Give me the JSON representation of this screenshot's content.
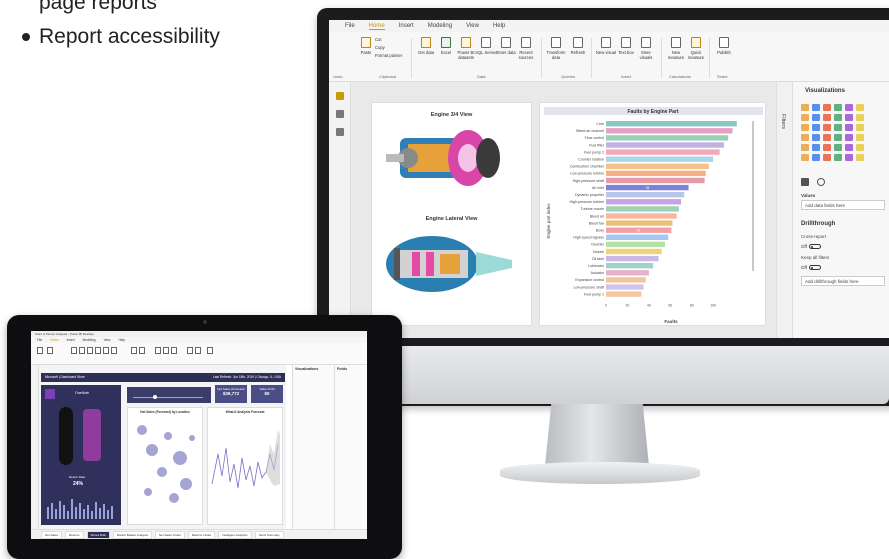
{
  "bullets": {
    "line1": "page reports",
    "line2": "Report accessibility"
  },
  "desktop": {
    "ribbon_tabs": [
      "File",
      "Home",
      "Insert",
      "Modeling",
      "View",
      "Help"
    ],
    "active_tab": "Home",
    "buttons": [
      "Paste",
      "Cut",
      "Copy",
      "Format painter",
      "Get data",
      "Excel",
      "Power BI datasets",
      "SQL Server",
      "Enter data",
      "Recent sources",
      "Transform data",
      "Refresh",
      "New visual",
      "Text box",
      "More visuals",
      "New measure",
      "Quick measure",
      "Publish"
    ],
    "groups": [
      "Undo",
      "Clipboard",
      "Data",
      "Queries",
      "Insert",
      "Calculations",
      "Share"
    ],
    "image_card": {
      "title1": "Engine 3/4 View",
      "title2": "Engine Lateral View"
    },
    "rpane": {
      "title": "Visualizations",
      "filters": "Filters",
      "values": "Values",
      "add_fields": "Add data fields here",
      "drillthrough": "Drillthrough",
      "cross_report": "Cross-report",
      "off": "Off",
      "keep_filters": "Keep all filters",
      "add_drill": "Add drillthrough fields here"
    },
    "icon_colors": [
      "#e8a33d",
      "#3d7de8",
      "#e85c3d",
      "#47a36b",
      "#9c4fd6",
      "#e8c93d"
    ]
  },
  "chart_data": {
    "type": "bar",
    "title": "Faults by Engine Part",
    "ylabel": "Engine part index",
    "xlabel": "Faults",
    "xlim": [
      0,
      125
    ],
    "xticks": [
      0,
      20,
      40,
      60,
      80,
      100
    ],
    "categories": [
      "Core",
      "Bleed air channel",
      "Flow control",
      "Fuel filter",
      "Fuel pump 2",
      "Counter rotation",
      "Combustion chamber",
      "Low-pressure turbine",
      "High-pressure shaft",
      "Air inlet",
      "Dynamic propeller",
      "High-pressure turbine",
      "Turbine nozzle",
      "Bleed air",
      "Bleed fan",
      "Body",
      "High speed bypass",
      "Diverter",
      "Nozzle",
      "Oil tank",
      "Lubricator",
      "Actuator",
      "Expansion control",
      "Low-pressure shaft",
      "Fuel pump 1"
    ],
    "values": [
      122,
      118,
      114,
      110,
      106,
      100,
      96,
      93,
      92,
      77,
      73,
      70,
      68,
      66,
      62,
      61,
      58,
      55,
      52,
      49,
      44,
      40,
      37,
      35,
      33
    ],
    "labels": {
      "9": "78",
      "15": "61"
    },
    "colors": [
      "#8ec6c5",
      "#e6a0c4",
      "#9ad0b5",
      "#c3b1e1",
      "#f4a8b8",
      "#a7d8e8",
      "#f6c28b",
      "#f4b183",
      "#e79aa5",
      "#7b83d6",
      "#b9c4ea",
      "#c8a2e6",
      "#9dd3b2",
      "#f7b6a0",
      "#e9c27a",
      "#f2a0a0",
      "#a4c8f0",
      "#b6e0a6",
      "#f1d27a",
      "#c9b8e8",
      "#99d6c8",
      "#e8b1c9",
      "#f3c59a",
      "#d1c4e9",
      "#f4c6a2"
    ]
  },
  "tablet": {
    "title": "Store & Person Analysis - Power BI Desktop",
    "tabs": [
      "File",
      "Home",
      "Insert",
      "Modeling",
      "View",
      "Help"
    ],
    "header_left": "Microsoft | Dashboard Store",
    "header_right": "Last Refresh: Jun 18th, 2019 | Chicago, IL, USA",
    "kpis": [
      {
        "label": "Net Sales (Forecast)",
        "value": "$39,772"
      },
      {
        "label": "Value Profit",
        "value": "$0"
      }
    ],
    "left_label": "OneNote",
    "return_label": "Return Rate",
    "return_value": "24%",
    "mid_title": "Net Sales (Forecast) by Location",
    "right_title": "What-If Analysis Forecast",
    "viz_title": "Visualizations",
    "fields_title": "Fields",
    "pages": [
      "Net Sales",
      "Returns",
      "Stores Risk",
      "Market Basket Analysis",
      "Net Sales Outlet",
      "Returns Outlet",
      "Intelligent Analytics",
      "Stock Summary"
    ]
  }
}
